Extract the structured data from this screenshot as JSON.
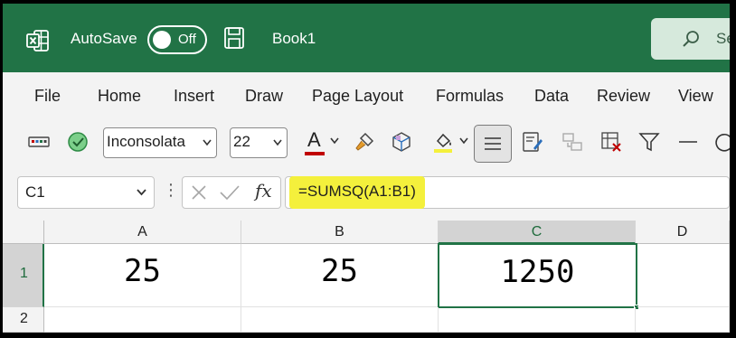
{
  "titlebar": {
    "autosave_label": "AutoSave",
    "autosave_state": "Off",
    "document_title": "Book1",
    "search_text": "Se"
  },
  "menu": {
    "items": [
      "File",
      "Home",
      "Insert",
      "Draw",
      "Page Layout",
      "Formulas",
      "Data",
      "Review",
      "View"
    ]
  },
  "toolbar": {
    "font_name": "Inconsolata",
    "font_size": "22",
    "font_color_letter": "A",
    "font_color": "#c00000",
    "highlight_color": "#f4f03c"
  },
  "formula_bar": {
    "name_box": "C1",
    "fx_label": "fx",
    "formula": "=SUMSQ(A1:B1)"
  },
  "grid": {
    "columns": [
      "A",
      "B",
      "C",
      "D"
    ],
    "rows": [
      "1",
      "2"
    ],
    "cells": {
      "A1": "25",
      "B1": "25",
      "C1": "1250"
    },
    "selected_cell": "C1"
  },
  "colors": {
    "accent": "#217346",
    "formula_highlight": "#f4f03c"
  }
}
